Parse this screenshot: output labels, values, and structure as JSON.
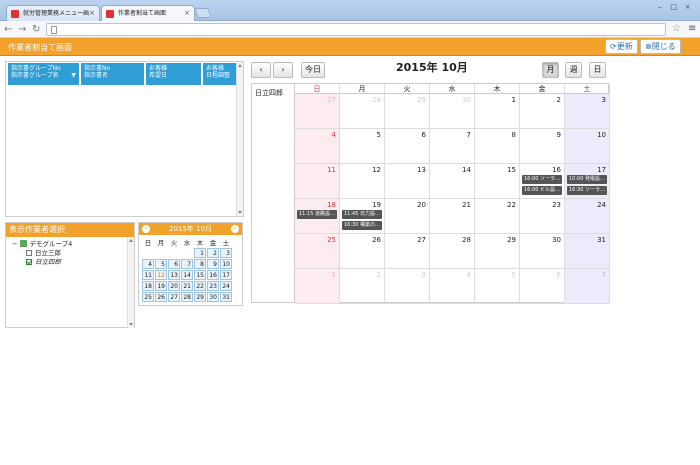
{
  "browser": {
    "tabs": [
      {
        "label": "就労管理業務メニュー画"
      },
      {
        "label": "作業者割当て画面"
      }
    ]
  },
  "header": {
    "title": "作業者割当て画面",
    "refresh_label": "更新",
    "close_label": "閉じる"
  },
  "table_headers": [
    {
      "line1": "指示書グループNo",
      "line2": "指示書グループ名"
    },
    {
      "line1": "指示書No",
      "line2": "指示書名"
    },
    {
      "line1": "お客様",
      "line2": "希望日"
    },
    {
      "line1": "お客様",
      "line2": "日程調整"
    }
  ],
  "worker_select": {
    "title": "表示作業者選択",
    "group": "デモグループ4",
    "workers": [
      {
        "name": "日立三郎",
        "checked": false
      },
      {
        "name": "日立四郎",
        "checked": true
      }
    ]
  },
  "mini_calendar": {
    "title": "2015年 10月",
    "prev": "‹",
    "next": "›",
    "dow": [
      "日",
      "月",
      "火",
      "水",
      "木",
      "金",
      "土"
    ],
    "weeks": [
      [
        "",
        "",
        "",
        "",
        "1",
        "2",
        "3"
      ],
      [
        "4",
        "5",
        "6",
        "7",
        "8",
        "9",
        "10"
      ],
      [
        "11",
        "12",
        "13",
        "14",
        "15",
        "16",
        "17"
      ],
      [
        "18",
        "19",
        "20",
        "21",
        "22",
        "23",
        "24"
      ],
      [
        "25",
        "26",
        "27",
        "28",
        "29",
        "30",
        "31"
      ]
    ],
    "today": "12"
  },
  "calendar": {
    "prev": "‹",
    "next": "›",
    "today_label": "今日",
    "title": "2015年 10月",
    "views": [
      "月",
      "週",
      "日"
    ],
    "active_view": "月",
    "worker": "日立四郎",
    "dow": [
      "日",
      "月",
      "火",
      "水",
      "木",
      "金",
      "土"
    ],
    "weeks": [
      [
        "27",
        "28",
        "29",
        "30",
        "1",
        "2",
        "3"
      ],
      [
        "4",
        "5",
        "6",
        "7",
        "8",
        "9",
        "10"
      ],
      [
        "11",
        "12",
        "13",
        "14",
        "15",
        "16",
        "17"
      ],
      [
        "18",
        "19",
        "20",
        "21",
        "22",
        "23",
        "24"
      ],
      [
        "25",
        "26",
        "27",
        "28",
        "29",
        "30",
        "31"
      ],
      [
        "1",
        "2",
        "3",
        "4",
        "5",
        "6",
        "7"
      ]
    ],
    "events": [
      {
        "week": 2,
        "day": 5,
        "slot": 0,
        "text": "16:00 ソーラ…"
      },
      {
        "week": 2,
        "day": 5,
        "slot": 1,
        "text": "16:00 ビル設…"
      },
      {
        "week": 2,
        "day": 6,
        "slot": 0,
        "text": "10:00 発電設…"
      },
      {
        "week": 2,
        "day": 6,
        "slot": 1,
        "text": "16:30 ソーラ…"
      },
      {
        "week": 3,
        "day": 0,
        "slot": 0,
        "text": "11:15 道路設…"
      },
      {
        "week": 3,
        "day": 1,
        "slot": 0,
        "text": "11:45 日力設…"
      },
      {
        "week": 3,
        "day": 1,
        "slot": 1,
        "text": "16:30 構築の…"
      }
    ]
  }
}
